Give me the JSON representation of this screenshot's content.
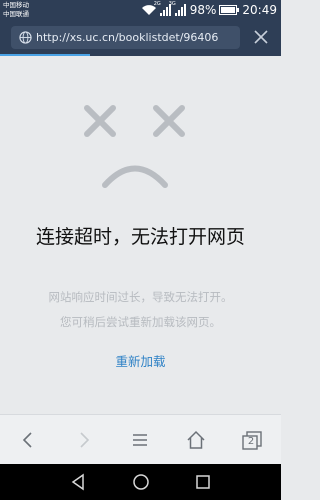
{
  "status_bar": {
    "carrier_1": "中国移动",
    "carrier_2": "中国联通",
    "network_1": "2G",
    "network_2": "3G",
    "battery": "98%",
    "time": "20:49"
  },
  "address_bar": {
    "url": "http://xs.uc.cn/booklistdet/96406"
  },
  "error_page": {
    "title": "连接超时，无法打开网页",
    "desc_line_1": "网站响应时间过长，导致无法打开。",
    "desc_line_2": "您可稍后尝试重新加载该网页。",
    "reload_label": "重新加载"
  },
  "toolbar": {
    "tab_count": "2",
    "icons": [
      "back-icon",
      "forward-icon",
      "menu-icon",
      "home-icon",
      "tabs-icon"
    ]
  },
  "nav_bar": {
    "icons": [
      "nav-back-icon",
      "nav-home-icon",
      "nav-recents-icon"
    ]
  },
  "colors": {
    "header_bg": "#2e3e56",
    "page_bg": "#e8eaec",
    "link": "#2f82c6",
    "progress": "#4aa3e6"
  }
}
